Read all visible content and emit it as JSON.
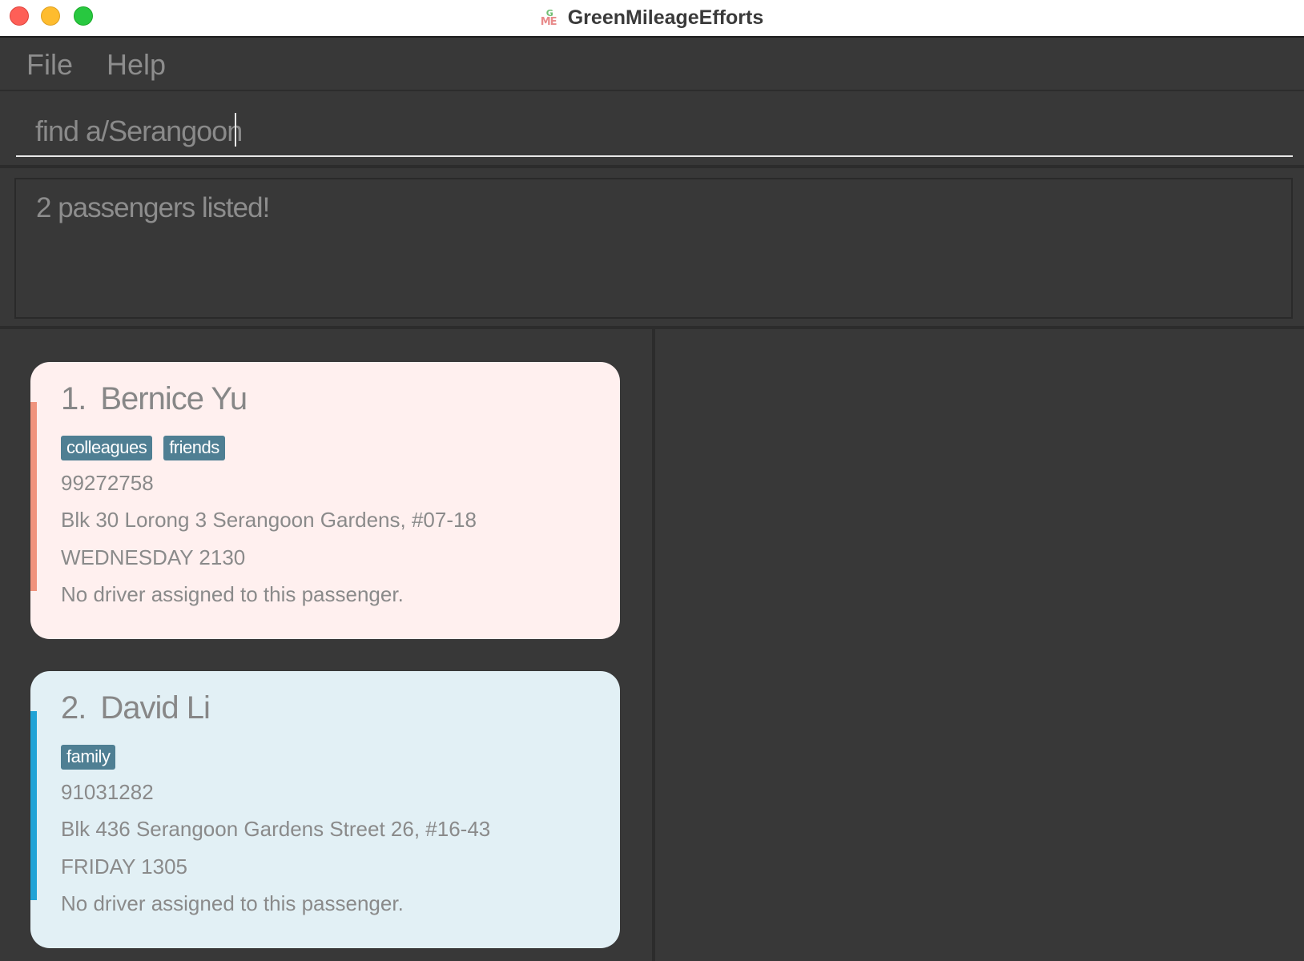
{
  "window": {
    "title": "GreenMileageEfforts",
    "icon_letters_top": "G",
    "icon_letters_bottom": "ME"
  },
  "menu": {
    "items": [
      {
        "label": "File"
      },
      {
        "label": "Help"
      }
    ]
  },
  "command": {
    "value": "find a/Serangoon",
    "placeholder": ""
  },
  "result": {
    "message": "2 passengers listed!"
  },
  "passengers": [
    {
      "index": "1.",
      "name": "Bernice Yu",
      "tags": [
        "colleagues",
        "friends"
      ],
      "phone": "99272758",
      "address": "Blk 30 Lorong 3 Serangoon Gardens, #07-18",
      "trip": "WEDNESDAY 2130",
      "driver": "No driver assigned to this passenger.",
      "card_color": "#fff0ef",
      "accent_color": "#f0937d"
    },
    {
      "index": "2.",
      "name": "David Li",
      "tags": [
        "family"
      ],
      "phone": "91031282",
      "address": "Blk 436 Serangoon Gardens Street 26, #16-43",
      "trip": "FRIDAY 1305",
      "driver": "No driver assigned to this passenger.",
      "card_color": "#e2f0f5",
      "accent_color": "#21a3d6"
    }
  ],
  "colors": {
    "background": "#383838",
    "tag_background": "#4f7f93"
  }
}
